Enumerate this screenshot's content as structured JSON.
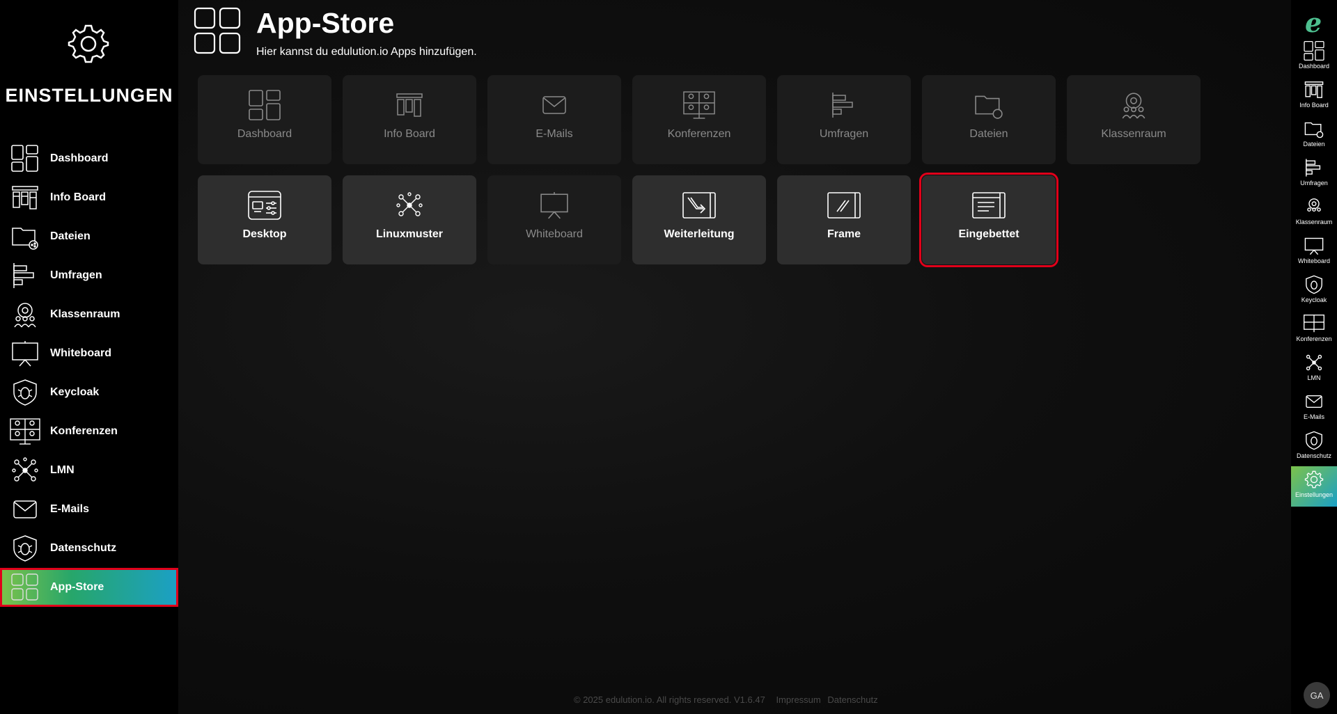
{
  "sidebar": {
    "title": "EINSTELLUNGEN",
    "items": [
      {
        "label": "Dashboard",
        "icon": "dashboard-icon"
      },
      {
        "label": "Info Board",
        "icon": "info-board-icon"
      },
      {
        "label": "Dateien",
        "icon": "files-icon"
      },
      {
        "label": "Umfragen",
        "icon": "surveys-icon"
      },
      {
        "label": "Klassenraum",
        "icon": "classroom-icon"
      },
      {
        "label": "Whiteboard",
        "icon": "whiteboard-icon"
      },
      {
        "label": "Keycloak",
        "icon": "shield-icon"
      },
      {
        "label": "Konferenzen",
        "icon": "conference-icon"
      },
      {
        "label": "LMN",
        "icon": "network-icon"
      },
      {
        "label": "E-Mails",
        "icon": "mail-icon"
      },
      {
        "label": "Datenschutz",
        "icon": "shield-icon"
      },
      {
        "label": "App-Store",
        "icon": "app-store-icon",
        "active": true
      }
    ]
  },
  "header": {
    "title": "App-Store",
    "subtitle": "Hier kannst du edulution.io Apps hinzufügen."
  },
  "tiles": {
    "row1": [
      {
        "label": "Dashboard",
        "icon": "dashboard-icon"
      },
      {
        "label": "Info Board",
        "icon": "info-board-icon"
      },
      {
        "label": "E-Mails",
        "icon": "mail-icon"
      },
      {
        "label": "Konferenzen",
        "icon": "conference-icon"
      },
      {
        "label": "Umfragen",
        "icon": "surveys-icon"
      },
      {
        "label": "Dateien",
        "icon": "files-icon"
      },
      {
        "label": "Klassenraum",
        "icon": "classroom-icon"
      }
    ],
    "row2": [
      {
        "label": "Desktop",
        "icon": "desktop-icon"
      },
      {
        "label": "Linuxmuster",
        "icon": "network-icon"
      },
      {
        "label": "Whiteboard",
        "icon": "whiteboard-icon"
      },
      {
        "label": "Weiterleitung",
        "icon": "forward-icon"
      },
      {
        "label": "Frame",
        "icon": "frame-icon"
      },
      {
        "label": "Eingebettet",
        "icon": "embedded-icon"
      }
    ]
  },
  "rail": {
    "items": [
      {
        "label": "Dashboard"
      },
      {
        "label": "Info Board"
      },
      {
        "label": "Dateien"
      },
      {
        "label": "Umfragen"
      },
      {
        "label": "Klassenraum"
      },
      {
        "label": "Whiteboard"
      },
      {
        "label": "Keycloak"
      },
      {
        "label": "Konferenzen"
      },
      {
        "label": "LMN"
      },
      {
        "label": "E-Mails"
      },
      {
        "label": "Datenschutz"
      },
      {
        "label": "Einstellungen",
        "active": true
      }
    ],
    "avatar": "GA"
  },
  "footer": {
    "copyright": "© 2025 edulution.io. All rights reserved. V1.6.47",
    "impressum": "Impressum",
    "datenschutz": "Datenschutz"
  },
  "colors": {
    "accent_start": "#7cc24a",
    "accent_end": "#1ba0c6",
    "highlight": "#e0001a"
  }
}
